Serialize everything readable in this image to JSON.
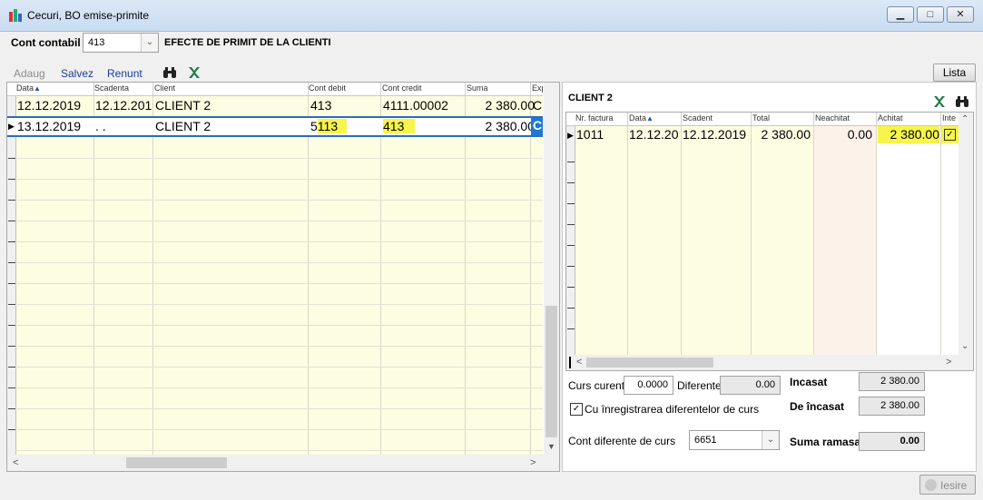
{
  "window": {
    "title": "Cecuri, BO emise-primite",
    "minimize_glyph": "▁",
    "maximize_glyph": "□",
    "close_glyph": "✕"
  },
  "account": {
    "label": "Cont contabil",
    "value": "413",
    "description": "EFECTE DE PRIMIT DE LA CLIENTI"
  },
  "toolbar": {
    "add": "Adaug",
    "save": "Salvez",
    "cancel": "Renunt",
    "list": "Lista"
  },
  "left_grid": {
    "columns": [
      "Data",
      "Scadenta",
      "Client",
      "Cont debit",
      "Cont credit",
      "Suma",
      "Exp"
    ],
    "sort_indicator": "▲",
    "rows": [
      {
        "data": "12.12.2019",
        "scadenta": "12.12.201",
        "client": "CLIENT 2",
        "cont_debit": "413",
        "cont_credit": "4111.00002",
        "suma": "2 380.00",
        "exp": "C"
      },
      {
        "data": "13.12.2019",
        "scadenta": ". .",
        "client": "CLIENT 2",
        "cont_debit_a": "5",
        "cont_debit_b": "113",
        "cont_credit": "413",
        "suma": "2 380.00",
        "exp": "C"
      }
    ]
  },
  "right_panel": {
    "client_title": "CLIENT 2",
    "columns": [
      "Nr. factura",
      "Data",
      "Scadent",
      "Total",
      "Neachitat",
      "Achitat",
      "Inte"
    ],
    "rows": [
      {
        "nr": "1011",
        "data": "12.12.20",
        "scadent": "12.12.2019",
        "total": "2 380.00",
        "neachitat": "0.00",
        "achitat": "2 380.00",
        "checked": true
      }
    ],
    "check_glyph": "✓"
  },
  "bottom": {
    "curs_label": "Curs curent",
    "curs_value": "0.0000",
    "diferente_label": "Diferente",
    "diferente_value": "0.00",
    "incasat_label": "Incasat",
    "incasat_value": "2 380.00",
    "checkbox_label": "Cu înregistrarea diferentelor de curs",
    "de_incasat_label": "De încasat",
    "de_incasat_value": "2 380.00",
    "cont_dif_label": "Cont diferente de curs",
    "cont_dif_value": "6651",
    "suma_ramasa_label": "Suma ramasa",
    "suma_ramasa_value": "0.00",
    "exit_label": "Iesire"
  },
  "colors": {
    "grid_bg": "#fdfde2",
    "highlight": "#f7f44a",
    "selection_border": "#2a6bc4",
    "neachitat_bg": "#fdf2ea"
  }
}
